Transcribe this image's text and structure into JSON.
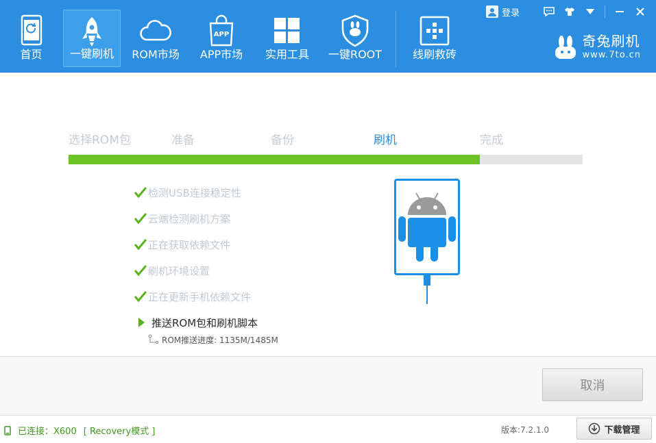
{
  "nav": {
    "items": [
      {
        "label": "首页",
        "icon": "home-phone-icon"
      },
      {
        "label": "一键刷机",
        "icon": "rocket-icon"
      },
      {
        "label": "ROM市场",
        "icon": "cloud-icon"
      },
      {
        "label": "APP市场",
        "icon": "app-bag-icon",
        "badge": "APP"
      },
      {
        "label": "实用工具",
        "icon": "grid-icon"
      },
      {
        "label": "一键ROOT",
        "icon": "shield-bunny-icon"
      },
      {
        "label": "线刷救砖",
        "icon": "plus-box-icon"
      }
    ],
    "active_index": 1
  },
  "window": {
    "login_label": "登录",
    "buttons": [
      "feedback-icon",
      "skin-icon",
      "dropdown-icon",
      "minimize-icon",
      "close-icon"
    ]
  },
  "brand": {
    "name": "奇兔刷机",
    "url": "www.7to.cn"
  },
  "steps": {
    "items": [
      "选择ROM包",
      "准备",
      "备份",
      "刷机",
      "完成"
    ],
    "current_index": 3,
    "progress_fraction": 0.8
  },
  "checklist": {
    "done": [
      "检测USB连接稳定性",
      "云端检测刷机方案",
      "正在获取依赖文件",
      "刷机环境设置",
      "正在更新手机依赖文件"
    ],
    "current": "推送ROM包和刷机脚本",
    "sub_status": "ROM推送进度: 1135M/1485M"
  },
  "actions": {
    "cancel_label": "取消"
  },
  "status": {
    "connection": "已连接：X600",
    "mode": "[ Recovery模式 ]",
    "version": "版本:7.2.1.0",
    "download_label": "下载管理"
  },
  "colors": {
    "header": "#2b8ee0",
    "progress": "#6cc227",
    "accent": "#1a8fe8",
    "android_grey": "#9a9a9a"
  }
}
